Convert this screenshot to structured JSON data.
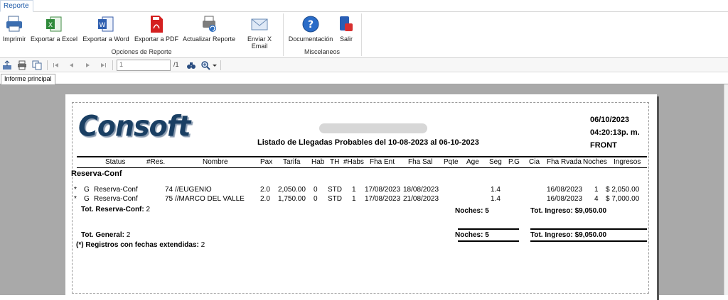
{
  "ribbon": {
    "tab_label": "Reporte",
    "buttons": [
      {
        "label": "Imprimir",
        "icon": "printer-icon"
      },
      {
        "label": "Exportar a Excel",
        "icon": "excel-icon"
      },
      {
        "label": "Exportar a Word",
        "icon": "word-icon"
      },
      {
        "label": "Exportar a PDF",
        "icon": "pdf-icon"
      },
      {
        "label": "Actualizar Reporte",
        "icon": "refresh-report-icon"
      },
      {
        "label": "Enviar X Email",
        "icon": "email-icon"
      },
      {
        "label": "Documentación",
        "icon": "help-icon"
      },
      {
        "label": "Salir",
        "icon": "exit-icon"
      }
    ],
    "groups": {
      "options": "Opciones de Reporte",
      "misc": "Miscelaneos"
    }
  },
  "viewer": {
    "page_value": "1",
    "page_total": "/1",
    "tab_label": "Informe principal"
  },
  "report": {
    "logo_text": "Consoft",
    "title": "Listado de Llegadas Probables del 10-08-2023 al 06-10-2023",
    "date": "06/10/2023",
    "time": "04:20:13p. m.",
    "area": "FRONT",
    "columns": [
      "Status",
      "#Res.",
      "Nombre",
      "Pax",
      "Tarifa",
      "Hab",
      "TH",
      "#Habs",
      "Fha Ent",
      "Fha Sal",
      "Pqte",
      "Age",
      "Seg",
      "P.G",
      "Cia",
      "Fha Rvada",
      "Noches",
      "Ingresos"
    ],
    "group_title": "Reserva-Conf",
    "rows": [
      {
        "mark": "*",
        "g": "G",
        "status": "Reserva-Conf",
        "res": "74",
        "name": "//EUGENIO",
        "pax": "2.0",
        "tarifa": "2,050.00",
        "hab": "0",
        "th": "STD",
        "habs": "1",
        "ent": "17/08/2023",
        "sal": "18/08/2023",
        "seg": "1.4",
        "rvada": "16/08/2023",
        "noches": "1",
        "ingresos": "$ 2,050.00"
      },
      {
        "mark": "*",
        "g": "G",
        "status": "Reserva-Conf",
        "res": "75",
        "name": "//MARCO DEL VALLE",
        "pax": "2.0",
        "tarifa": "1,750.00",
        "hab": "0",
        "th": "STD",
        "habs": "1",
        "ent": "17/08/2023",
        "sal": "21/08/2023",
        "seg": "1.4",
        "rvada": "16/08/2023",
        "noches": "4",
        "ingresos": "$ 7,000.00"
      }
    ],
    "group_total": {
      "label": "Tot. Reserva-Conf:",
      "count": "2",
      "noches": "Noches: 5",
      "ingreso": "Tot. Ingreso: $9,050.00"
    },
    "grand_total": {
      "label": "Tot. General:",
      "count": "2",
      "noches": "Noches: 5",
      "ingreso": "Tot. Ingreso: $9,050.00"
    },
    "extended": {
      "label": "(*) Registros con fechas extendidas:",
      "count": "2"
    }
  }
}
